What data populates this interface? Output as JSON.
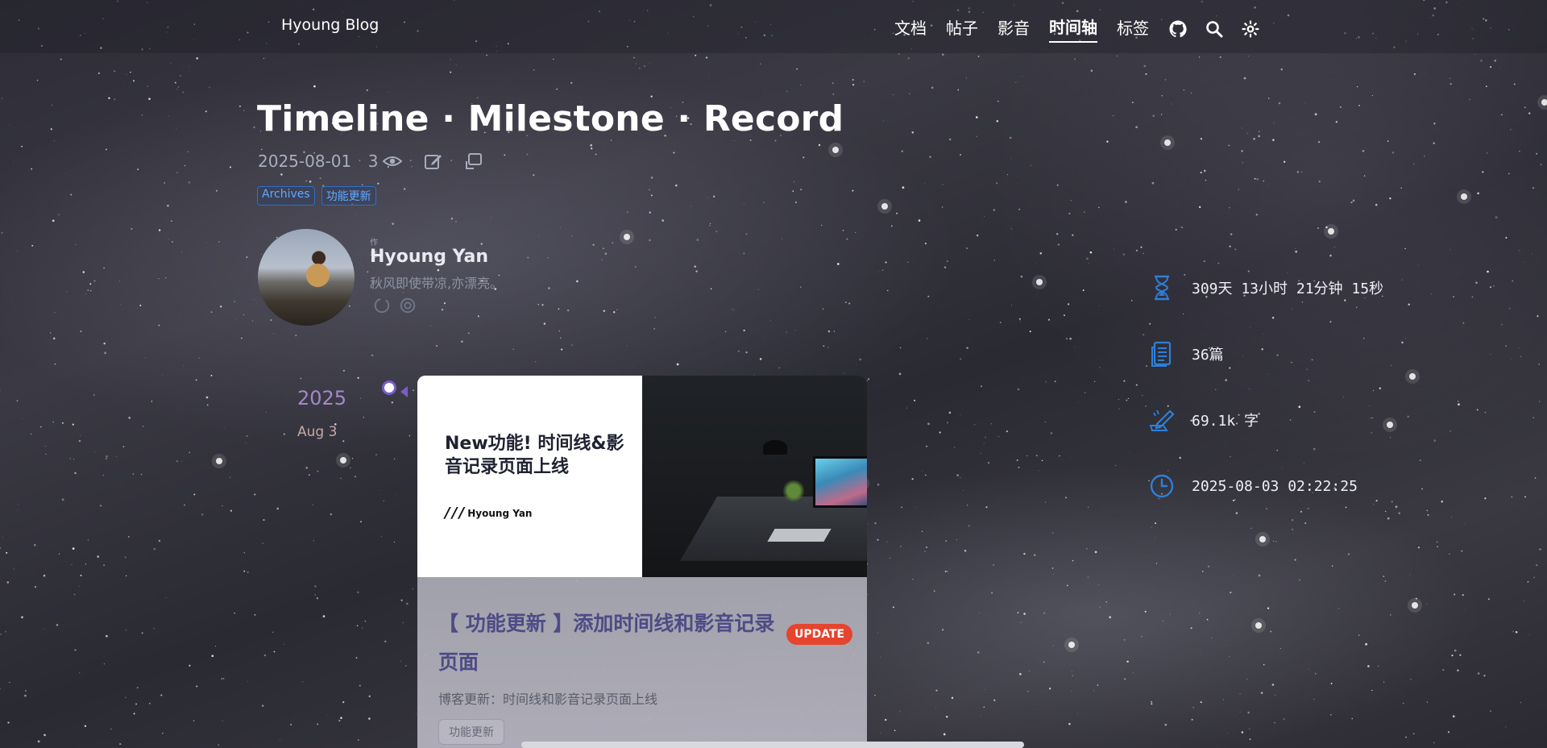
{
  "nav": {
    "brand": "Hyoung Blog",
    "links": [
      "文档",
      "帖子",
      "影音",
      "时间轴",
      "标签"
    ],
    "active": "时间轴"
  },
  "post": {
    "title": "Timeline · Milestone · Record",
    "date": "2025-08-01",
    "views": "3",
    "tags": [
      "Archives",
      "功能更新"
    ]
  },
  "author": {
    "label": "作者",
    "name": "Hyoung Yan",
    "bio": "秋风即使带凉,亦漂亮。"
  },
  "timeline": {
    "year": "2025",
    "date": "Aug 3",
    "card": {
      "cover_title": "New功能! 时间线&影音记录页面上线",
      "cover_brand": "Hyoung Yan",
      "title": "【 功能更新 】添加时间线和影音记录页面",
      "badge": "UPDATE",
      "description": "博客更新：时间线和影音记录页面上线",
      "tag": "功能更新"
    }
  },
  "stats": {
    "uptime": "309天 13小时 21分钟 15秒",
    "posts": "36篇",
    "words": "69.1k 字",
    "time": "2025-08-03 02:22:25"
  },
  "colors": {
    "accent": "#2f7fd8",
    "timeline_purple": "#7b5cc9",
    "badge_red": "#e5442f",
    "card_title": "#4e4b86"
  },
  "icons": [
    "github-icon",
    "search-icon",
    "theme-toggle-icon",
    "eye-icon",
    "edit-icon",
    "share-icon",
    "hourglass-icon",
    "document-icon",
    "writing-icon",
    "clock-icon"
  ]
}
